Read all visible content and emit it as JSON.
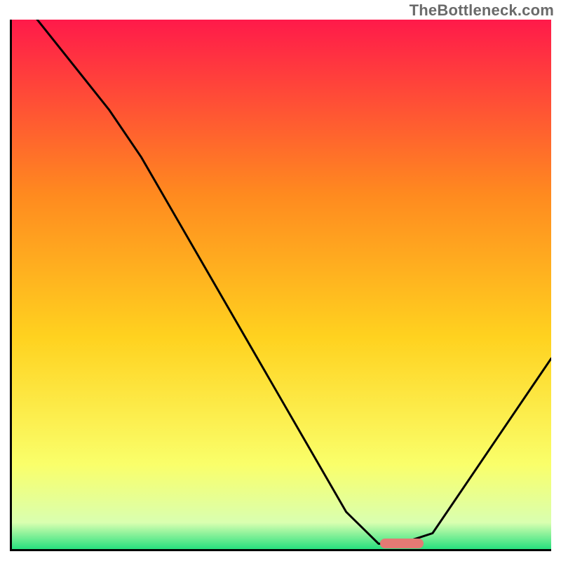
{
  "watermark": "TheBottleneck.com",
  "colors": {
    "gradient_top": "#ff1a4a",
    "gradient_upper_mid": "#ff8a1f",
    "gradient_mid": "#ffd21f",
    "gradient_lower_mid": "#faff6a",
    "gradient_near_bottom": "#d9ffb0",
    "gradient_bottom": "#27e07e",
    "line": "#000000",
    "marker": "#e47a74",
    "axis": "#000000"
  },
  "chart_data": {
    "type": "line",
    "title": "",
    "xlabel": "",
    "ylabel": "",
    "xlim": [
      0,
      100
    ],
    "ylim": [
      0,
      100
    ],
    "x": [
      0,
      18,
      24,
      62,
      68,
      72,
      78,
      100
    ],
    "values": [
      106,
      83,
      74,
      7,
      1,
      1,
      3,
      36
    ],
    "marker_range_x": [
      68,
      76
    ],
    "marker_y": 1.5,
    "annotations": []
  }
}
